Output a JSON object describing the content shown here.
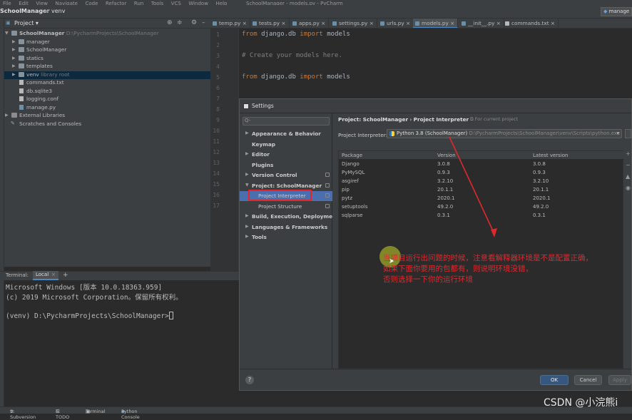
{
  "menubar": {
    "items": [
      "File",
      "Edit",
      "View",
      "Navigate",
      "Code",
      "Refactor",
      "Run",
      "Tools",
      "VCS",
      "Window",
      "Help"
    ],
    "title": "SchoolManager - models.py - PyCharm"
  },
  "navbar": {
    "project": "SchoolManager",
    "folder": "venv",
    "run_config": "manage"
  },
  "project_panel": {
    "title": "Project",
    "tree": [
      {
        "label": "SchoolManager",
        "path": "D:\\PycharmProjects\\SchoolManager",
        "indent": 0,
        "kind": "folder"
      },
      {
        "label": "manager",
        "indent": 1,
        "kind": "folder"
      },
      {
        "label": "SchoolManager",
        "indent": 1,
        "kind": "folder"
      },
      {
        "label": "statics",
        "indent": 1,
        "kind": "folder"
      },
      {
        "label": "templates",
        "indent": 1,
        "kind": "folder"
      },
      {
        "label": "venv",
        "note": "library root",
        "indent": 1,
        "kind": "folder"
      },
      {
        "label": "commands.txt",
        "indent": 1,
        "kind": "file"
      },
      {
        "label": "db.sqlite3",
        "indent": 1,
        "kind": "file"
      },
      {
        "label": "logging.conf",
        "indent": 1,
        "kind": "file"
      },
      {
        "label": "manage.py",
        "indent": 1,
        "kind": "file"
      },
      {
        "label": "External Libraries",
        "indent": 0,
        "kind": "lib"
      },
      {
        "label": "Scratches and Consoles",
        "indent": 0,
        "kind": "scratch"
      }
    ]
  },
  "editor": {
    "tabs": [
      "temp.py",
      "tests.py",
      "apps.py",
      "settings.py",
      "urls.py",
      "models.py",
      "__init__.py",
      "commands.txt"
    ],
    "active_tab": "models.py",
    "line_numbers": [
      "1",
      "2",
      "3",
      "4",
      "5",
      "6",
      "7",
      "8",
      "9",
      "10",
      "11",
      "12",
      "13",
      "14",
      "15",
      "16",
      "17"
    ],
    "code": {
      "line1_kw1": "from",
      "line1_mod": " django.db ",
      "line1_kw2": "import",
      "line1_name": " models",
      "line3": "# Create your models here.",
      "line5_kw1": "from",
      "line5_mod": " django.db ",
      "line5_kw2": "import",
      "line5_name": " models"
    }
  },
  "terminal": {
    "label": "Terminal:",
    "tab": "Local",
    "add": "+",
    "lines": [
      "Microsoft Windows [版本 10.0.18363.959]",
      "(c) 2019 Microsoft Corporation。保留所有权利。",
      "",
      "(venv) D:\\PycharmProjects\\SchoolManager>"
    ]
  },
  "statusbar": {
    "items": [
      "9: Subversion",
      "6: TODO",
      "Terminal",
      "Python Console"
    ]
  },
  "settings": {
    "title": "Settings",
    "search_placeholder": "Q-",
    "nav": [
      {
        "label": "Appearance & Behavior",
        "arrow": "▶",
        "bold": true
      },
      {
        "label": "Keymap",
        "arrow": "",
        "bold": true
      },
      {
        "label": "Editor",
        "arrow": "▶",
        "bold": true
      },
      {
        "label": "Plugins",
        "arrow": "",
        "bold": true
      },
      {
        "label": "Version Control",
        "arrow": "▶",
        "bold": true
      },
      {
        "label": "Project: SchoolManager",
        "arrow": "▼",
        "bold": true
      },
      {
        "label": "Project Interpreter",
        "arrow": "",
        "bold": false
      },
      {
        "label": "Project Structure",
        "arrow": "",
        "bold": false
      },
      {
        "label": "Build, Execution, Deployment",
        "arrow": "▶",
        "bold": true
      },
      {
        "label": "Languages & Frameworks",
        "arrow": "▶",
        "bold": true
      },
      {
        "label": "Tools",
        "arrow": "▶",
        "bold": true
      }
    ],
    "breadcrumb": {
      "project": "Project: SchoolManager",
      "sep": "›",
      "page": "Project Interpreter"
    },
    "for_current_project": "For current project",
    "interpreter_label": "Project Interpreter:",
    "interpreter_value": "Python 3.8 (SchoolManager)",
    "interpreter_path": "D:\\PycharmProjects\\SchoolManager\\venv\\Scripts\\python.exe",
    "table": {
      "headers": [
        "Package",
        "Version",
        "Latest version"
      ],
      "rows": [
        [
          "Django",
          "3.0.8",
          "3.0.8"
        ],
        [
          "PyMySQL",
          "0.9.3",
          "0.9.3"
        ],
        [
          "asgiref",
          "3.2.10",
          "3.2.10"
        ],
        [
          "pip",
          "20.1.1",
          "20.1.1"
        ],
        [
          "pytz",
          "2020.1",
          "2020.1"
        ],
        [
          "setuptools",
          "49.2.0",
          "49.2.0"
        ],
        [
          "sqlparse",
          "0.3.1",
          "0.3.1"
        ]
      ]
    },
    "buttons": {
      "help": "?",
      "ok": "OK",
      "cancel": "Cancel",
      "apply": "Apply"
    }
  },
  "annotation": {
    "lines": [
      "当项目运行出问题的时候，注意看解释器环境是不是配置正确，",
      "如果下面你要用的包都有，则说明环境没错，",
      "否则选择一下你的运行环境"
    ],
    "color": "#e0282d"
  },
  "watermark": "CSDN @小浣熊i"
}
